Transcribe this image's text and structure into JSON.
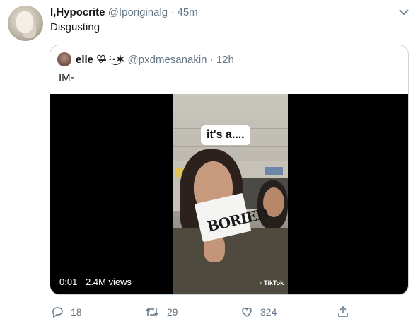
{
  "tweet": {
    "display_name": "I,Hypocrite",
    "handle": "@Iporiginalg",
    "separator": "·",
    "time": "45m",
    "text": "Disgusting"
  },
  "quoted_tweet": {
    "display_name": "elle ♡̶ ͘·͜·✶",
    "handle": "@pxdmesanakin",
    "separator": "·",
    "time": "12h",
    "text": "IM-"
  },
  "video": {
    "caption": "it's a....",
    "paper_text": "BORIED",
    "watermark": "TikTok",
    "duration": "0:01",
    "views": "2.4M views"
  },
  "actions": {
    "replies": "18",
    "retweets": "29",
    "likes": "324"
  },
  "icons": [
    "chevron-down-icon",
    "reply-icon",
    "retweet-icon",
    "like-icon",
    "share-icon",
    "tiktok-icon"
  ],
  "colors": {
    "text": "#14171a",
    "muted": "#657786",
    "border": "#ccd6dd"
  }
}
